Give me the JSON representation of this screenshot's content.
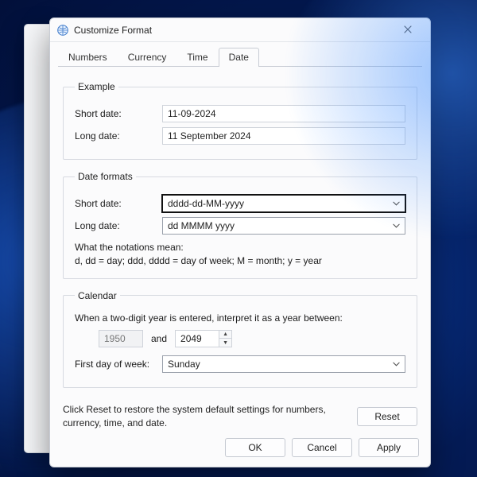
{
  "window": {
    "title": "Customize Format"
  },
  "tabs": {
    "numbers": "Numbers",
    "currency": "Currency",
    "time": "Time",
    "date": "Date"
  },
  "example": {
    "legend": "Example",
    "short_label": "Short date:",
    "short_value": "11-09-2024",
    "long_label": "Long date:",
    "long_value": "11 September 2024"
  },
  "formats": {
    "legend": "Date formats",
    "short_label": "Short date:",
    "short_value": "dddd-dd-MM-yyyy",
    "long_label": "Long date:",
    "long_value": "dd MMMM yyyy",
    "notation_title": "What the notations mean:",
    "notation_body": "d, dd = day;  ddd, dddd = day of week;  M = month;  y = year"
  },
  "calendar": {
    "legend": "Calendar",
    "interpret_line": "When a two-digit year is entered, interpret it as a year between:",
    "year_from": "1950",
    "and": "and",
    "year_to": "2049",
    "first_day_label": "First day of week:",
    "first_day_value": "Sunday"
  },
  "footer": {
    "reset_text": "Click Reset to restore the system default settings for numbers, currency, time, and date.",
    "reset": "Reset",
    "ok": "OK",
    "cancel": "Cancel",
    "apply": "Apply"
  }
}
